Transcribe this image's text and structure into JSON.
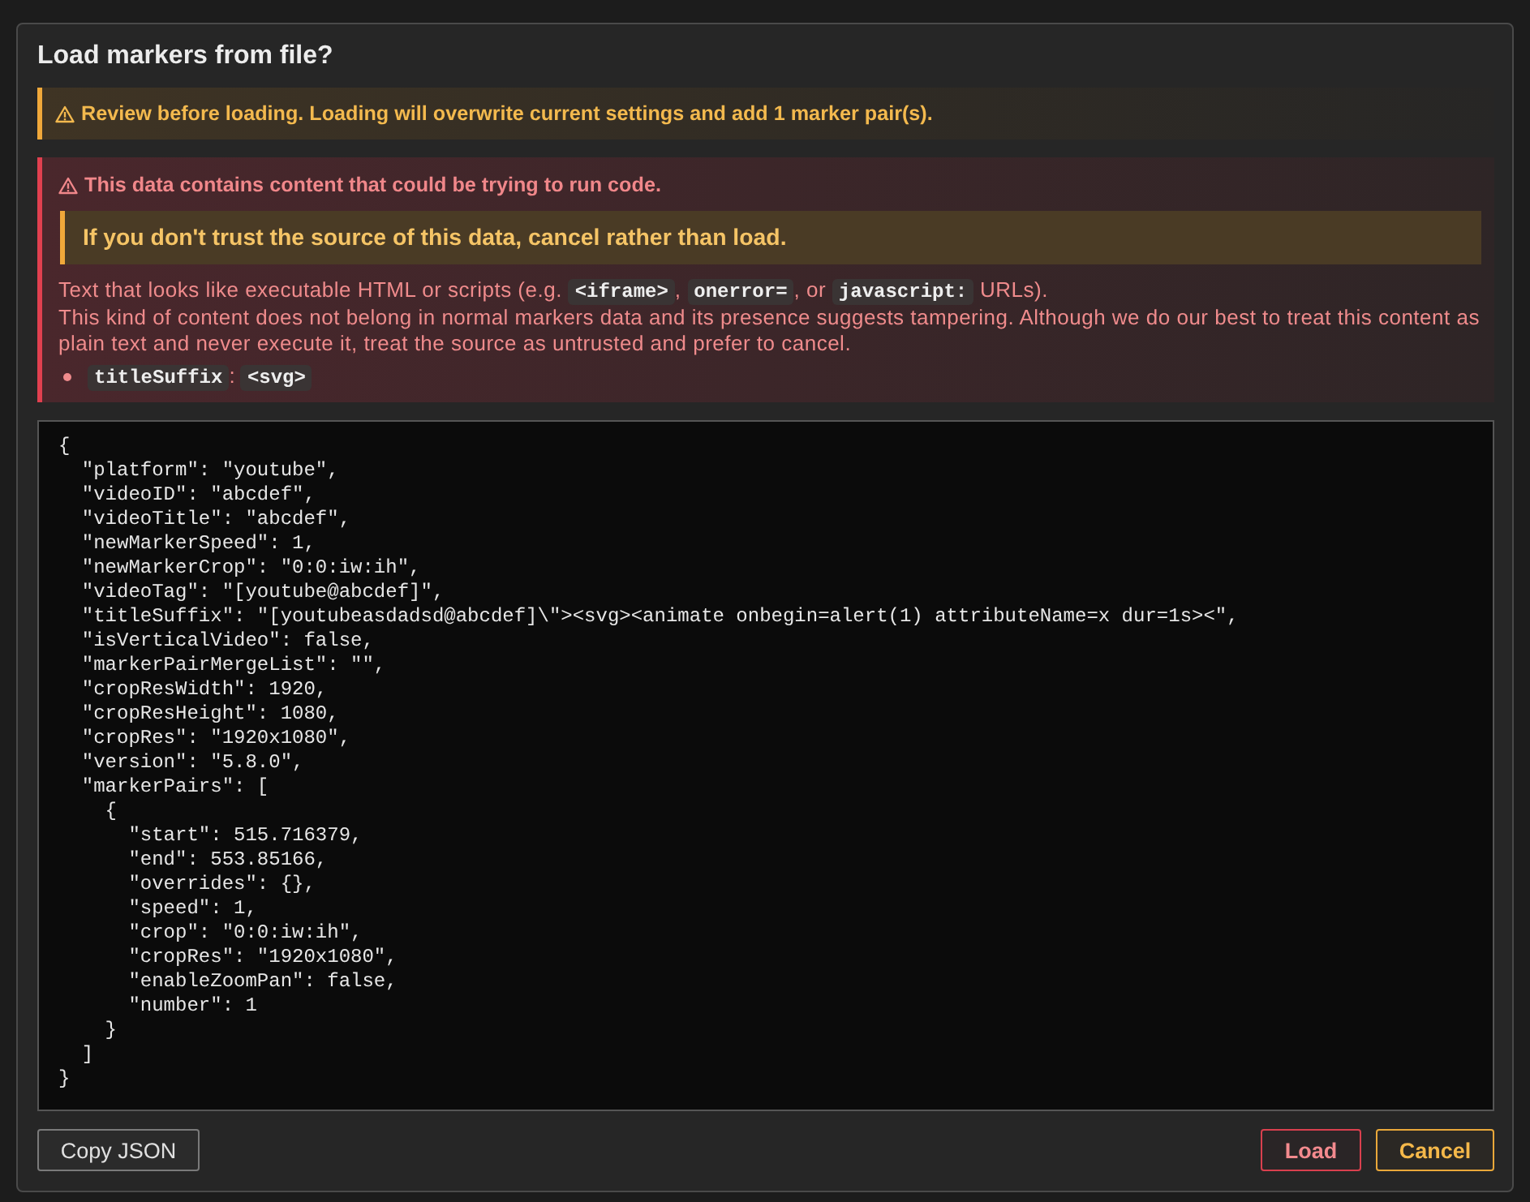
{
  "dialog": {
    "title": "Load markers from file?"
  },
  "review_notice": {
    "text": "Review before loading. Loading will overwrite current settings and add 1 marker pair(s)."
  },
  "danger_notice": {
    "heading": "This data contains content that could be trying to run code.",
    "callout": "If you don't trust the source of this data, cancel rather than load.",
    "paragraphs": [
      [
        {
          "kind": "text",
          "text": "Text that looks like executable HTML or scripts (e.g. "
        },
        {
          "kind": "code",
          "text": "<iframe>"
        },
        {
          "kind": "text",
          "text": ", "
        },
        {
          "kind": "code",
          "text": "onerror="
        },
        {
          "kind": "text",
          "text": ", or "
        },
        {
          "kind": "code",
          "text": "javascript:"
        },
        {
          "kind": "text",
          "text": " URLs)."
        }
      ],
      [
        {
          "kind": "text",
          "text": "This kind of content does not belong in normal markers data and its presence suggests tampering. Although we do our best to treat this content as plain text and never execute it, treat the source as untrusted and prefer to cancel."
        }
      ]
    ],
    "flagged_items": [
      [
        {
          "kind": "code",
          "text": "titleSuffix"
        },
        {
          "kind": "text",
          "text": ": "
        },
        {
          "kind": "code",
          "text": "<svg>"
        }
      ]
    ]
  },
  "json_text": {
    "lines": [
      "{",
      "  \"platform\": \"youtube\",",
      "  \"videoID\": \"abcdef\",",
      "  \"videoTitle\": \"abcdef\",",
      "  \"newMarkerSpeed\": 1,",
      "  \"newMarkerCrop\": \"0:0:iw:ih\",",
      "  \"videoTag\": \"[youtube@abcdef]\",",
      "  \"titleSuffix\": \"[youtubeasdadsd@abcdef]\\\"><svg><animate onbegin=alert(1) attributeName=x dur=1s><\",",
      "  \"isVerticalVideo\": false,",
      "  \"markerPairMergeList\": \"\",",
      "  \"cropResWidth\": 1920,",
      "  \"cropResHeight\": 1080,",
      "  \"cropRes\": \"1920x1080\",",
      "  \"version\": \"5.8.0\",",
      "  \"markerPairs\": [",
      "    {",
      "      \"start\": 515.716379,",
      "      \"end\": 553.85166,",
      "      \"overrides\": {},",
      "      \"speed\": 1,",
      "      \"crop\": \"0:0:iw:ih\",",
      "      \"cropRes\": \"1920x1080\",",
      "      \"enableZoomPan\": false,",
      "      \"number\": 1",
      "    }",
      "  ]",
      "}"
    ]
  },
  "buttons": [
    {
      "label": "Copy JSON",
      "kind": "neutral"
    },
    {
      "label": "Load",
      "kind": "danger"
    },
    {
      "label": "Cancel",
      "kind": "warning"
    }
  ]
}
